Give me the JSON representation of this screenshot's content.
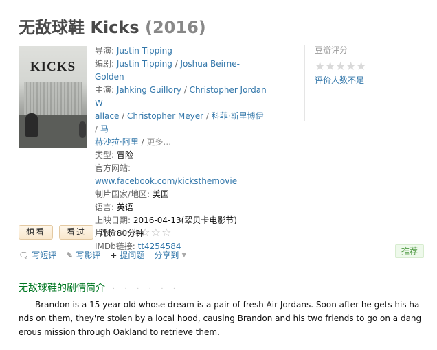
{
  "title": {
    "name": "无敌球鞋 Kicks",
    "year": "(2016)"
  },
  "poster": {
    "title_text": "KICKS"
  },
  "info": {
    "director_label": "导演:",
    "director": "Justin Tipping",
    "writer_label": "编剧:",
    "writers": [
      "Justin Tipping",
      "Joshua Beirne-Golden"
    ],
    "cast_label": "主演:",
    "cast_line1": "Jahking Guillory",
    "cast_line2": "Christopher Jordan W",
    "cast_line3": "allace",
    "cast_line4": "Christopher Meyer",
    "cast_line5": "科菲·斯里博伊",
    "cast_line6": "马",
    "cast_line7": "赫沙拉·阿里",
    "more": "更多...",
    "genre_label": "类型:",
    "genre": "冒险",
    "website_label": "官方网站:",
    "website": "www.facebook.com/kicksthemovie",
    "country_label": "制片国家/地区:",
    "country": "美国",
    "language_label": "语言:",
    "language": "英语",
    "release_label": "上映日期:",
    "release": "2016-04-13(翠贝卡电影节)",
    "runtime_label": "片长:",
    "runtime": "80分钟",
    "imdb_label": "IMDb链接:",
    "imdb": "tt4254584"
  },
  "rating": {
    "label": "豆瓣评分",
    "stars": 0,
    "no_rating_text": "评价人数不足"
  },
  "actions": {
    "want_label": "想看",
    "seen_label": "看过",
    "rate_label": "评价:"
  },
  "links": {
    "short_review": "写短评",
    "review": "写影评",
    "ask": "提问题",
    "share": "分享到"
  },
  "recommend_label": "推荐",
  "intro": {
    "title": "无敌球鞋的剧情简介",
    "dots": "· · · · · ·",
    "text": "Brandon is a 15 year old whose dream is a pair of fresh Air Jordans. Soon after he gets his hands on them, they're stolen by a local hood, causing Brandon and his two friends to go on a dangerous mission through Oakland to retrieve them."
  }
}
